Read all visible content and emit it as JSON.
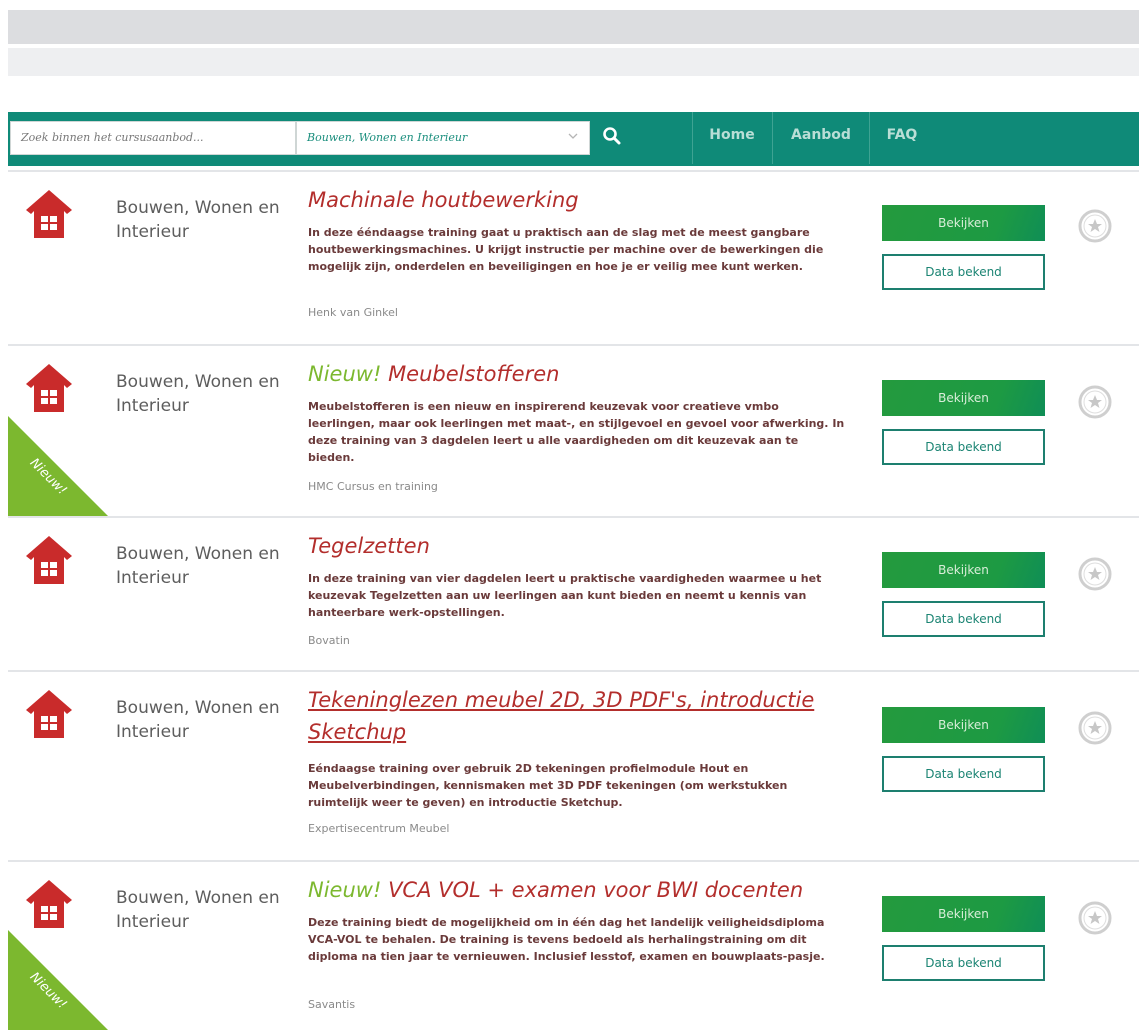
{
  "search": {
    "placeholder": "Zoek binnen het cursusaanbod..."
  },
  "category_filter": {
    "selected": "Bouwen, Wonen en Interieur"
  },
  "nav": {
    "items": [
      "Home",
      "Aanbod",
      "FAQ"
    ]
  },
  "labels": {
    "view_button": "Bekijken",
    "dates_button": "Data bekend",
    "new_ribbon": "Nieuw!",
    "new_prefix": "Nieuw!"
  },
  "courses": [
    {
      "category": "Bouwen, Wonen en Interieur",
      "title": "Machinale houtbewerking",
      "is_new": false,
      "description": "In deze ééndaagse training gaat u praktisch aan de slag met de meest gangbare houtbewerkingsmachines. U krijgt instructie per machine over de bewerkingen die mogelijk zijn, onderdelen en beveiligingen en hoe je er veilig mee kunt werken.",
      "provider": "Henk van Ginkel"
    },
    {
      "category": "Bouwen, Wonen en Interieur",
      "title": "Meubelstofferen",
      "is_new": true,
      "description": "Meubelstofferen is een nieuw en inspirerend keuzevak voor creatieve vmbo leerlingen, maar ook leerlingen met maat-, en stijlgevoel en gevoel voor afwerking. In deze training van 3 dagdelen leert u alle vaardigheden om dit keuzevak aan te bieden.",
      "provider": "HMC Cursus en training"
    },
    {
      "category": "Bouwen, Wonen en Interieur",
      "title": "Tegelzetten",
      "is_new": false,
      "description": "In deze training van vier dagdelen leert u praktische vaardigheden waarmee u het keuzevak Tegelzetten aan uw leerlingen aan kunt bieden en neemt u kennis van hanteerbare werk-opstellingen.",
      "provider": "Bovatin"
    },
    {
      "category": "Bouwen, Wonen en Interieur",
      "title": "Tekeninglezen meubel 2D, 3D PDF's, introductie Sketchup",
      "is_new": false,
      "description": "Eéndaagse training over gebruik 2D tekeningen profielmodule Hout en Meubelverbindingen, kennismaken met 3D PDF tekeningen (om werkstukken ruimtelijk weer te geven) en introductie Sketchup.",
      "provider": "Expertisecentrum Meubel"
    },
    {
      "category": "Bouwen, Wonen en Interieur",
      "title": "VCA VOL + examen voor BWI docenten",
      "is_new": true,
      "description": "Deze training biedt de mogelijkheid om in één dag het landelijk veiligheidsdiploma VCA-VOL te behalen. De training is tevens bedoeld als herhalingstraining om dit diploma na tien jaar te vernieuwen. Inclusief lesstof, examen en bouwplaats-pasje.",
      "provider": "Savantis"
    }
  ],
  "colors": {
    "brand_teal": "#0f8a78",
    "title_red": "#b32e2c",
    "new_green": "#7cb82f",
    "button_green": "#249a3e"
  },
  "icons": [
    "search-icon",
    "chevron-down-icon",
    "house-icon",
    "star-icon"
  ]
}
